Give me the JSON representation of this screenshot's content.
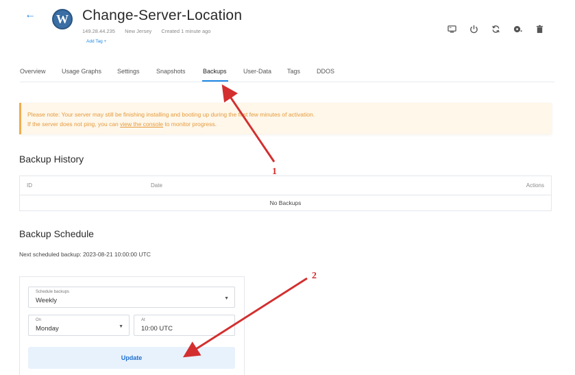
{
  "header": {
    "back_icon": "arrow-left-icon",
    "logo_icon": "wordpress-logo-icon",
    "logo_glyph": "W",
    "title": "Change-Server-Location",
    "ip": "149.28.44.235",
    "location": "New Jersey",
    "created": "Created 1 minute ago",
    "add_tag": "Add Tag +"
  },
  "toolbar": [
    {
      "icon": "console-icon"
    },
    {
      "icon": "power-icon"
    },
    {
      "icon": "restart-icon"
    },
    {
      "icon": "iso-disc-icon"
    },
    {
      "icon": "trash-icon"
    }
  ],
  "tabs": [
    "Overview",
    "Usage Graphs",
    "Settings",
    "Snapshots",
    "Backups",
    "User-Data",
    "Tags",
    "DDOS"
  ],
  "active_tab": "Backups",
  "notice": {
    "line1": "Please note: Your server may still be finishing installing and booting up during the first few minutes of activation.",
    "line2_prefix": "If the server does not ping, you can ",
    "line2_link": "view the console",
    "line2_suffix": " to monitor progress."
  },
  "backup_history": {
    "title": "Backup History",
    "columns": {
      "id": "ID",
      "date": "Date",
      "actions": "Actions"
    },
    "empty": "No Backups"
  },
  "backup_schedule": {
    "title": "Backup Schedule",
    "next": "Next scheduled backup: 2023-08-21 10:00:00 UTC",
    "schedule_label": "Schedule backups",
    "schedule_value": "Weekly",
    "on_label": "On",
    "on_value": "Monday",
    "at_label": "At",
    "at_value": "10:00 UTC",
    "update": "Update"
  },
  "annotations": {
    "one": "1",
    "two": "2"
  },
  "colors": {
    "accent": "#1e88e5",
    "warning": "#e69a3c",
    "annotation": "#d32f2f"
  }
}
